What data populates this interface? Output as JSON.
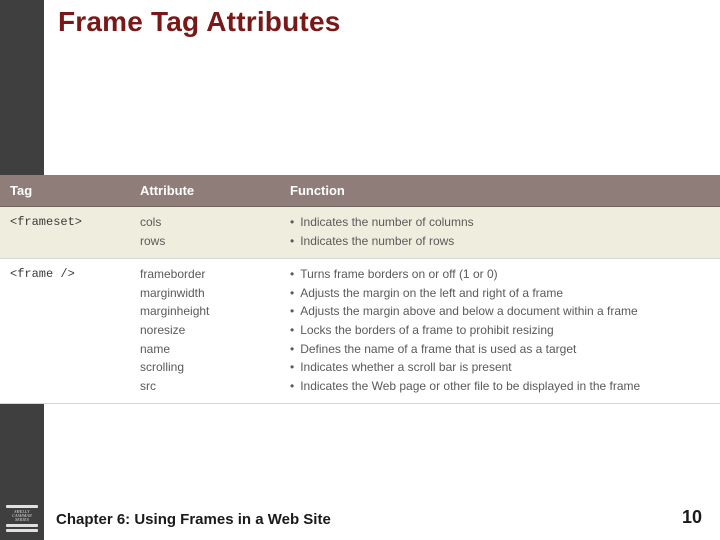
{
  "title": "Frame Tag Attributes",
  "headers": {
    "tag": "Tag",
    "attribute": "Attribute",
    "function": "Function"
  },
  "rows": [
    {
      "tag": "<frameset>",
      "attrs": [
        "cols",
        "rows"
      ],
      "funcs": [
        "Indicates the number of columns",
        "Indicates the number of rows"
      ]
    },
    {
      "tag": "<frame />",
      "attrs": [
        "frameborder",
        "marginwidth",
        "marginheight",
        "noresize",
        "name",
        "scrolling",
        "src"
      ],
      "funcs": [
        "Turns frame borders on or off (1 or 0)",
        "Adjusts the margin on the left and right of a frame",
        "Adjusts the margin above and below a document within a frame",
        "Locks the borders of a frame to prohibit resizing",
        "Defines the name of a frame that is used as a target",
        "Indicates whether a scroll bar is present",
        "Indicates the Web page or other file to be displayed in the frame"
      ]
    }
  ],
  "footer": {
    "chapter": "Chapter 6: Using Frames in a Web Site",
    "page": "10",
    "series": "SHELLY CASHMAN SERIES"
  }
}
